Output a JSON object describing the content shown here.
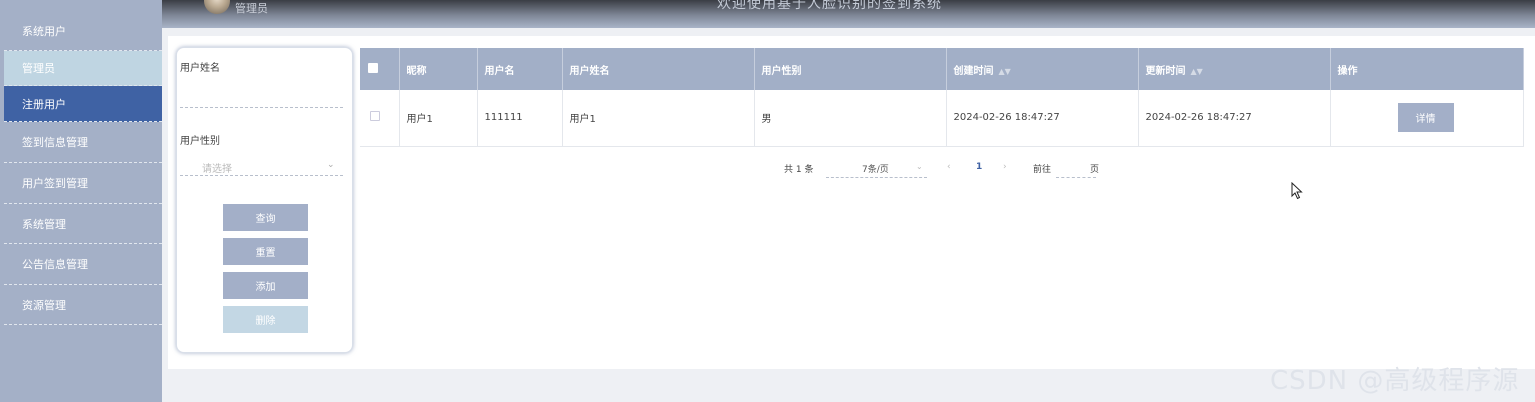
{
  "header": {
    "role": "管理员",
    "welcome": "欢迎使用基于人脸识别的签到系统"
  },
  "sidebar": {
    "items": [
      {
        "label": "系统用户"
      },
      {
        "label": "管理员"
      },
      {
        "label": "注册用户"
      },
      {
        "label": "签到信息管理"
      },
      {
        "label": "用户签到管理"
      },
      {
        "label": "系统管理"
      },
      {
        "label": "公告信息管理"
      },
      {
        "label": "资源管理"
      }
    ]
  },
  "search": {
    "name_label": "用户姓名",
    "name_value": "",
    "gender_label": "用户性别",
    "gender_placeholder": "请选择",
    "query_label": "查询",
    "reset_label": "重置",
    "add_label": "添加",
    "delete_label": "删除"
  },
  "table": {
    "columns": [
      "昵称",
      "用户名",
      "用户姓名",
      "用户性别",
      "创建时间",
      "更新时间",
      "操作"
    ],
    "rows": [
      {
        "nickname": "用户1",
        "username": "111111",
        "realname": "用户1",
        "gender": "男",
        "created": "2024-02-26 18:47:27",
        "updated": "2024-02-26 18:47:27",
        "action": "详情"
      }
    ]
  },
  "pagination": {
    "total_text": "共 1 条",
    "page_size": "7条/页",
    "current_page": "1",
    "goto_prefix": "前往",
    "goto_suffix": "页"
  },
  "watermark": "CSDN @高级程序源"
}
